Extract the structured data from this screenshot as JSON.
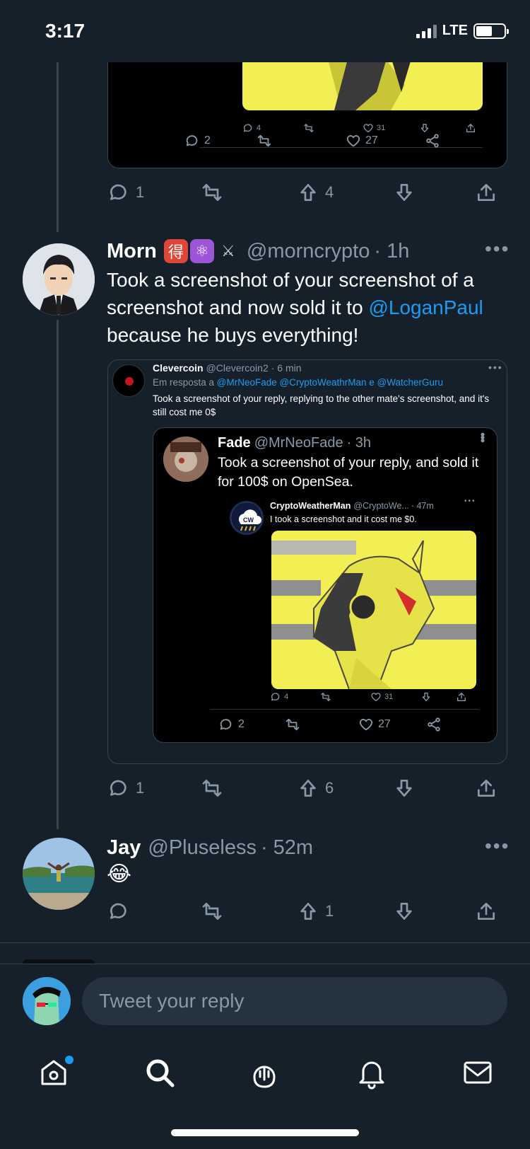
{
  "status_bar": {
    "time": "3:17",
    "network": "LTE"
  },
  "top_embed": {
    "inner_actions": {
      "reply": "4",
      "like": "31"
    },
    "outer_actions": {
      "reply": "2",
      "like": "27"
    }
  },
  "tweets": [
    {
      "actions": {
        "reply": "1",
        "upvote": "4"
      }
    },
    {
      "name": "Morn",
      "emoji_badges": [
        "得",
        "⚛",
        "⚔"
      ],
      "handle": "@morncrypto",
      "time": "· 1h",
      "text_before": "Took a screenshot of your screenshot of a screenshot and now sold it to ",
      "mention": "@LoganPaul",
      "text_after": " because he buys everything!",
      "quote": {
        "name": "Clevercoin",
        "handle": "@Clevercoin2",
        "time": "· 6 min",
        "reply_prefix": "Em resposta a ",
        "reply_to": "@MrNeoFade @CryptoWeathrMan e @WatcherGuru",
        "text": "Took a screenshot of your reply, replying to the other mate's screenshot, and it's still cost me 0$",
        "inner": {
          "name": "Fade",
          "handle": "@MrNeoFade",
          "time": "· 3h",
          "text": "Took a screenshot of your reply, and sold it for 100$ on OpenSea.",
          "nested": {
            "name": "CryptoWeatherMan",
            "handle": "@CryptoWe...",
            "time": "· 47m",
            "text": "I took a screenshot and it cost me $0.",
            "actions": {
              "reply": "4",
              "like": "31"
            }
          },
          "actions": {
            "reply": "2",
            "like": "27"
          }
        }
      },
      "actions": {
        "reply": "1",
        "upvote": "6"
      }
    },
    {
      "name": "Jay",
      "handle": "@Pluseless",
      "time": "· 52m",
      "text": "😂",
      "actions": {
        "reply": "",
        "upvote": "1"
      }
    }
  ],
  "reply_bar": {
    "placeholder": "Tweet your reply"
  },
  "tabs": [
    "home-icon",
    "search-icon",
    "spaces-icon",
    "notifications-icon",
    "messages-icon"
  ],
  "colors": {
    "background": "#15202b",
    "accent": "#1d9bf0",
    "muted": "#8899a6",
    "image_yellow": "#f2ef55"
  }
}
